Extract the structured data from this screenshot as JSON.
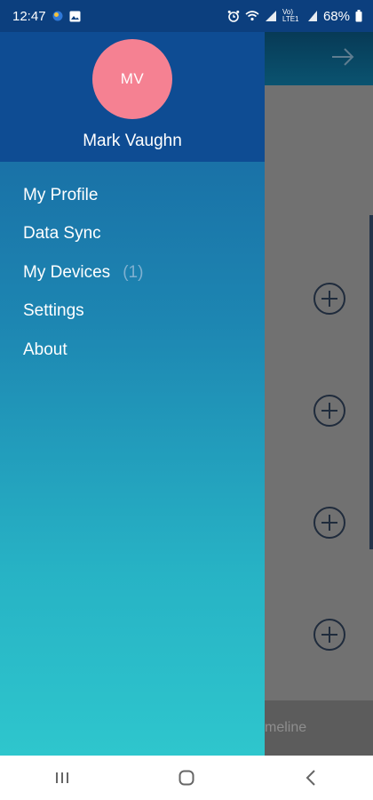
{
  "status_bar": {
    "time": "12:47",
    "battery": "68%",
    "network_label": "Vo) LTE1",
    "icons": [
      "weather-icon",
      "gallery-icon",
      "alarm-icon",
      "wifi-icon",
      "signal-icon",
      "battery-icon"
    ]
  },
  "drawer": {
    "avatar_initials": "MV",
    "avatar_color": "#f58192",
    "user_name": "Mark Vaughn",
    "menu": [
      {
        "label": "My Profile"
      },
      {
        "label": "Data Sync"
      },
      {
        "label": "My Devices",
        "count": "(1)"
      },
      {
        "label": "Settings"
      },
      {
        "label": "About"
      }
    ]
  },
  "background": {
    "header_icon": "arrow-right-icon",
    "add_icon": "add-circle-icon",
    "bottom_tab_label": "meline"
  },
  "nav_bar": {
    "icons": [
      "recent-apps-icon",
      "home-icon",
      "back-icon"
    ]
  }
}
